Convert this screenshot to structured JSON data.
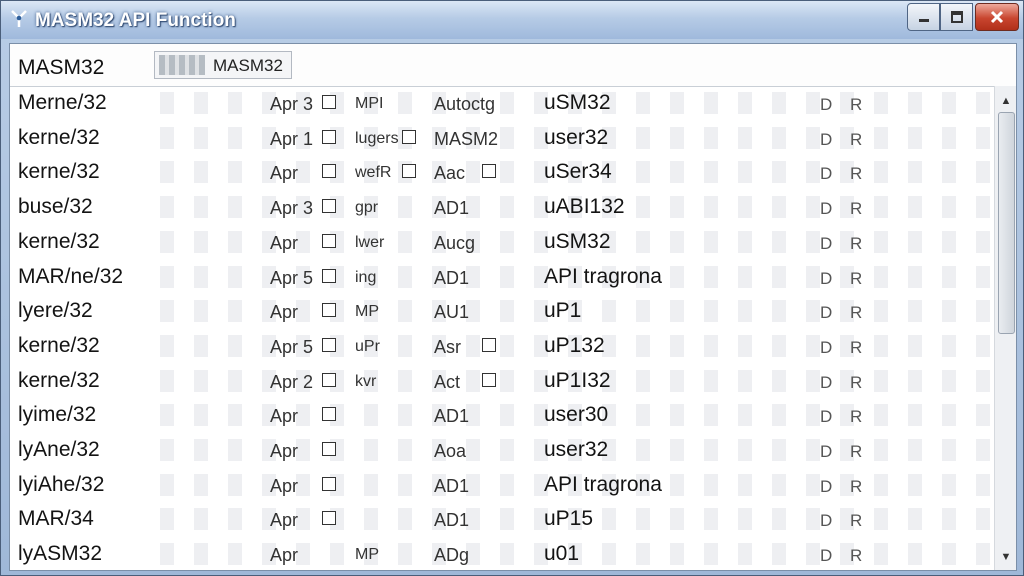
{
  "window": {
    "title": "MASM32 API Function",
    "icons": {
      "app": "app-icon",
      "minimize": "minimize-icon",
      "maximize": "maximize-icon",
      "close": "close-icon"
    }
  },
  "header": {
    "label": "MASM32",
    "field_text": "MASM32"
  },
  "rows": [
    {
      "name": "Merne/32",
      "api": "Apr 3",
      "chk1": true,
      "type": "MPI",
      "mid": "Autoctg",
      "lib": "uSM32"
    },
    {
      "name": "kerne/32",
      "api": "Apr 1",
      "chk1": true,
      "type": "lugers",
      "chk2": true,
      "mid": "MASM2",
      "lib": "user32"
    },
    {
      "name": "kerne/32",
      "api": "Apr",
      "chk1": true,
      "type": "wefR",
      "chk2": true,
      "mid": "Aac",
      "chk3": true,
      "lib": "uSer34"
    },
    {
      "name": "buse/32",
      "api": "Apr 3",
      "chk1": true,
      "type": "gpr",
      "mid": "AD1",
      "lib": "uABI132"
    },
    {
      "name": "kerne/32",
      "api": "Apr",
      "chk1": true,
      "type": "lwer",
      "mid": "Aucg",
      "lib": "uSM32"
    },
    {
      "name": "MAR/ne/32",
      "api": "Apr 5",
      "chk1": true,
      "type": "ing",
      "mid": "AD1",
      "lib": "API tragrona"
    },
    {
      "name": "lyere/32",
      "api": "Apr",
      "chk1": true,
      "type": "MP",
      "mid": "AU1",
      "lib": "uP1"
    },
    {
      "name": "kerne/32",
      "api": "Apr 5",
      "chk1": true,
      "type": "uPr",
      "mid": "Asr",
      "chk3": true,
      "lib": "uP132"
    },
    {
      "name": "kerne/32",
      "api": "Apr 2",
      "chk1": true,
      "type": "kvr",
      "mid": "Act",
      "chk3": true,
      "lib": "uP1I32"
    },
    {
      "name": "lyime/32",
      "api": "Apr",
      "chk1": true,
      "type": "",
      "mid": "AD1",
      "lib": "user30"
    },
    {
      "name": "lyAne/32",
      "api": "Apr",
      "chk1": true,
      "type": "",
      "mid": "Aoa",
      "lib": "user32"
    },
    {
      "name": "lyiAhe/32",
      "api": "Apr",
      "chk1": true,
      "type": "",
      "mid": "AD1",
      "lib": "API tragrona"
    },
    {
      "name": "MAR/34",
      "api": "Apr",
      "chk1": true,
      "type": "",
      "mid": "AD1",
      "lib": "uP15"
    },
    {
      "name": "lyASM32",
      "api": "Apr",
      "chk1": false,
      "type": "MP",
      "mid": "ADg",
      "lib": "u01"
    }
  ],
  "row_marks": {
    "d": "D",
    "r": "R"
  },
  "scrollbar": {
    "up": "▲",
    "down": "▼"
  }
}
